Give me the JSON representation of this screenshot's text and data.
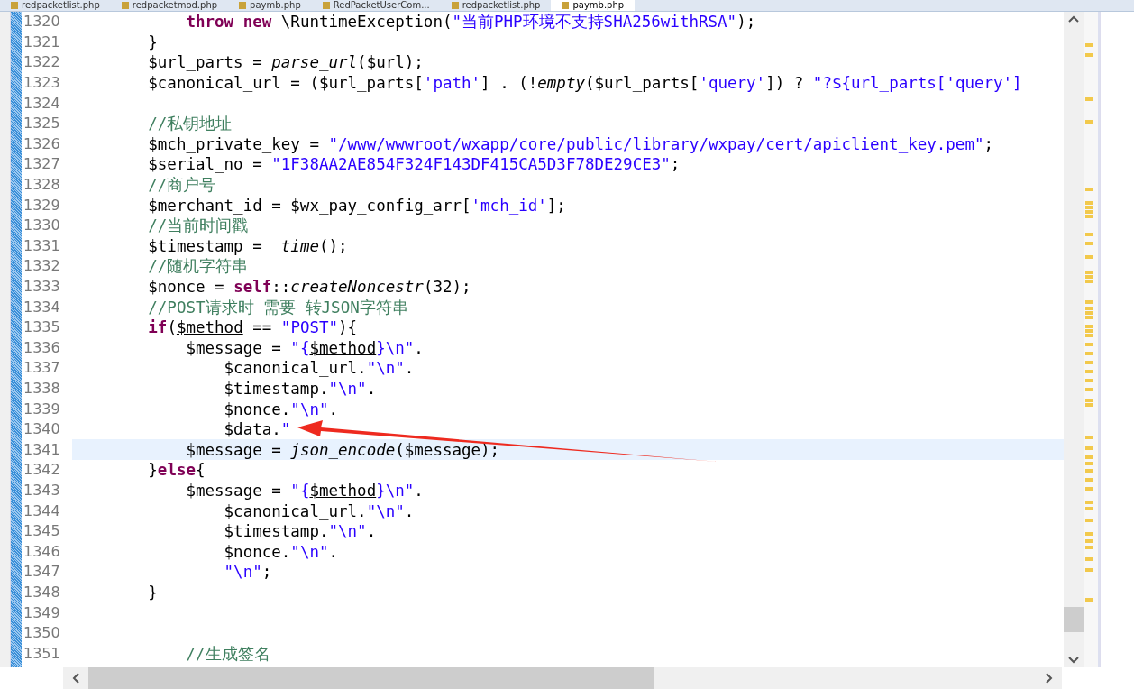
{
  "tabs": [
    {
      "label": "redpacketlist.php",
      "selected": false
    },
    {
      "label": "redpacketmod.php",
      "selected": false
    },
    {
      "label": "paymb.php",
      "selected": false
    },
    {
      "label": "RedPacketUserCom...",
      "selected": false
    },
    {
      "label": "redpacketlist.php",
      "selected": false
    },
    {
      "label": "paymb.php",
      "selected": true
    }
  ],
  "editor": {
    "lines": [
      {
        "number": "1320",
        "tokens": [
          {
            "t": "            throw new",
            "kind": "keyword"
          },
          {
            "t": " \\RuntimeException(",
            "kind": "plain"
          },
          {
            "t": "\"当前PHP环境不支持SHA256withRSA\"",
            "kind": "string"
          },
          {
            "t": ");",
            "kind": "plain"
          }
        ]
      },
      {
        "number": "1321",
        "tokens": [
          {
            "t": "        }",
            "kind": "plain"
          }
        ]
      },
      {
        "number": "1322",
        "tokens": [
          {
            "t": "        $url_parts = ",
            "kind": "plain"
          },
          {
            "t": "parse_url",
            "kind": "italic"
          },
          {
            "t": "(",
            "kind": "plain"
          },
          {
            "t": "$url",
            "kind": "underline"
          },
          {
            "t": ");",
            "kind": "plain"
          }
        ]
      },
      {
        "number": "1323",
        "tokens": [
          {
            "t": "        $canonical_url = ($url_parts[",
            "kind": "plain"
          },
          {
            "t": "'path'",
            "kind": "string"
          },
          {
            "t": "] . (!",
            "kind": "plain"
          },
          {
            "t": "empty",
            "kind": "italic"
          },
          {
            "t": "($url_parts[",
            "kind": "plain"
          },
          {
            "t": "'query'",
            "kind": "string"
          },
          {
            "t": "]) ? ",
            "kind": "plain"
          },
          {
            "t": "\"?${url_parts['query']",
            "kind": "string"
          }
        ]
      },
      {
        "number": "1324"
      },
      {
        "number": "1325",
        "tokens": [
          {
            "t": "        //私钥地址",
            "kind": "comment"
          }
        ]
      },
      {
        "number": "1326",
        "tokens": [
          {
            "t": "        $mch_private_key = ",
            "kind": "plain"
          },
          {
            "t": "\"/www/wwwroot/wxapp/core/public/library/wxpay/cert/apiclient_key.pem\"",
            "kind": "string"
          },
          {
            "t": ";",
            "kind": "plain"
          }
        ]
      },
      {
        "number": "1327",
        "tokens": [
          {
            "t": "        $serial_no = ",
            "kind": "plain"
          },
          {
            "t": "\"1F38AA2AE854F324F143DF415CA5D3F78DE29CE3\"",
            "kind": "string"
          },
          {
            "t": ";",
            "kind": "plain"
          }
        ]
      },
      {
        "number": "1328",
        "tokens": [
          {
            "t": "        //商户号",
            "kind": "comment"
          }
        ]
      },
      {
        "number": "1329",
        "tokens": [
          {
            "t": "        $merchant_id = $wx_pay_config_arr[",
            "kind": "plain"
          },
          {
            "t": "'mch_id'",
            "kind": "string"
          },
          {
            "t": "];",
            "kind": "plain"
          }
        ]
      },
      {
        "number": "1330",
        "tokens": [
          {
            "t": "        //当前时间戳",
            "kind": "comment"
          }
        ]
      },
      {
        "number": "1331",
        "tokens": [
          {
            "t": "        $timestamp =  ",
            "kind": "plain"
          },
          {
            "t": "time",
            "kind": "italic"
          },
          {
            "t": "();",
            "kind": "plain"
          }
        ]
      },
      {
        "number": "1332",
        "tokens": [
          {
            "t": "        //随机字符串",
            "kind": "comment"
          }
        ]
      },
      {
        "number": "1333",
        "tokens": [
          {
            "t": "        $nonce = ",
            "kind": "plain"
          },
          {
            "t": "self",
            "kind": "keyword"
          },
          {
            "t": "::",
            "kind": "plain"
          },
          {
            "t": "createNoncestr",
            "kind": "italic"
          },
          {
            "t": "(32);",
            "kind": "plain"
          }
        ]
      },
      {
        "number": "1334",
        "tokens": [
          {
            "t": "        //POST请求时 需要 转JSON字符串",
            "kind": "comment"
          }
        ]
      },
      {
        "number": "1335",
        "tokens": [
          {
            "t": "        if",
            "kind": "keyword"
          },
          {
            "t": "(",
            "kind": "plain"
          },
          {
            "t": "$method",
            "kind": "underline"
          },
          {
            "t": " == ",
            "kind": "plain"
          },
          {
            "t": "\"POST\"",
            "kind": "string"
          },
          {
            "t": "){",
            "kind": "plain"
          }
        ]
      },
      {
        "number": "1336",
        "tokens": [
          {
            "t": "            $message = ",
            "kind": "plain"
          },
          {
            "t": "\"{",
            "kind": "string"
          },
          {
            "t": "$method",
            "kind": "underline"
          },
          {
            "t": "}\\n\"",
            "kind": "string"
          },
          {
            "t": ".",
            "kind": "plain"
          }
        ]
      },
      {
        "number": "1337",
        "tokens": [
          {
            "t": "                $canonical_url.",
            "kind": "plain"
          },
          {
            "t": "\"\\n\"",
            "kind": "string"
          },
          {
            "t": ".",
            "kind": "plain"
          }
        ]
      },
      {
        "number": "1338",
        "tokens": [
          {
            "t": "                $timestamp.",
            "kind": "plain"
          },
          {
            "t": "\"\\n\"",
            "kind": "string"
          },
          {
            "t": ".",
            "kind": "plain"
          }
        ]
      },
      {
        "number": "1339",
        "tokens": [
          {
            "t": "                $nonce.",
            "kind": "plain"
          },
          {
            "t": "\"\\n\"",
            "kind": "string"
          },
          {
            "t": ".",
            "kind": "plain"
          }
        ]
      },
      {
        "number": "1340",
        "tokens": [
          {
            "t": "                $data",
            "kind": "underline"
          },
          {
            "t": ".",
            "kind": "plain"
          },
          {
            "t": "\"",
            "kind": "string"
          }
        ]
      },
      {
        "number": "1341",
        "current": true,
        "tokens": [
          {
            "t": "            $message = ",
            "kind": "plain"
          },
          {
            "t": "json_encode",
            "kind": "italic"
          },
          {
            "t": "($message);",
            "kind": "plain"
          }
        ]
      },
      {
        "number": "1342",
        "tokens": [
          {
            "t": "        }",
            "kind": "plain"
          },
          {
            "t": "else",
            "kind": "keyword"
          },
          {
            "t": "{",
            "kind": "plain"
          }
        ]
      },
      {
        "number": "1343",
        "tokens": [
          {
            "t": "            $message = ",
            "kind": "plain"
          },
          {
            "t": "\"{",
            "kind": "string"
          },
          {
            "t": "$method",
            "kind": "underline"
          },
          {
            "t": "}\\n\"",
            "kind": "string"
          },
          {
            "t": ".",
            "kind": "plain"
          }
        ]
      },
      {
        "number": "1344",
        "tokens": [
          {
            "t": "                $canonical_url.",
            "kind": "plain"
          },
          {
            "t": "\"\\n\"",
            "kind": "string"
          },
          {
            "t": ".",
            "kind": "plain"
          }
        ]
      },
      {
        "number": "1345",
        "tokens": [
          {
            "t": "                $timestamp.",
            "kind": "plain"
          },
          {
            "t": "\"\\n\"",
            "kind": "string"
          },
          {
            "t": ".",
            "kind": "plain"
          }
        ]
      },
      {
        "number": "1346",
        "tokens": [
          {
            "t": "                $nonce.",
            "kind": "plain"
          },
          {
            "t": "\"\\n\"",
            "kind": "string"
          },
          {
            "t": ".",
            "kind": "plain"
          }
        ]
      },
      {
        "number": "1347",
        "tokens": [
          {
            "t": "                \"\\n\"",
            "kind": "string"
          },
          {
            "t": ";",
            "kind": "plain"
          }
        ]
      },
      {
        "number": "1348",
        "tokens": [
          {
            "t": "        }",
            "kind": "plain"
          }
        ]
      },
      {
        "number": "1349"
      },
      {
        "number": "1350"
      },
      {
        "number": "1351",
        "tokens": [
          {
            "t": "            //生成签名",
            "kind": "comment"
          }
        ]
      }
    ]
  }
}
